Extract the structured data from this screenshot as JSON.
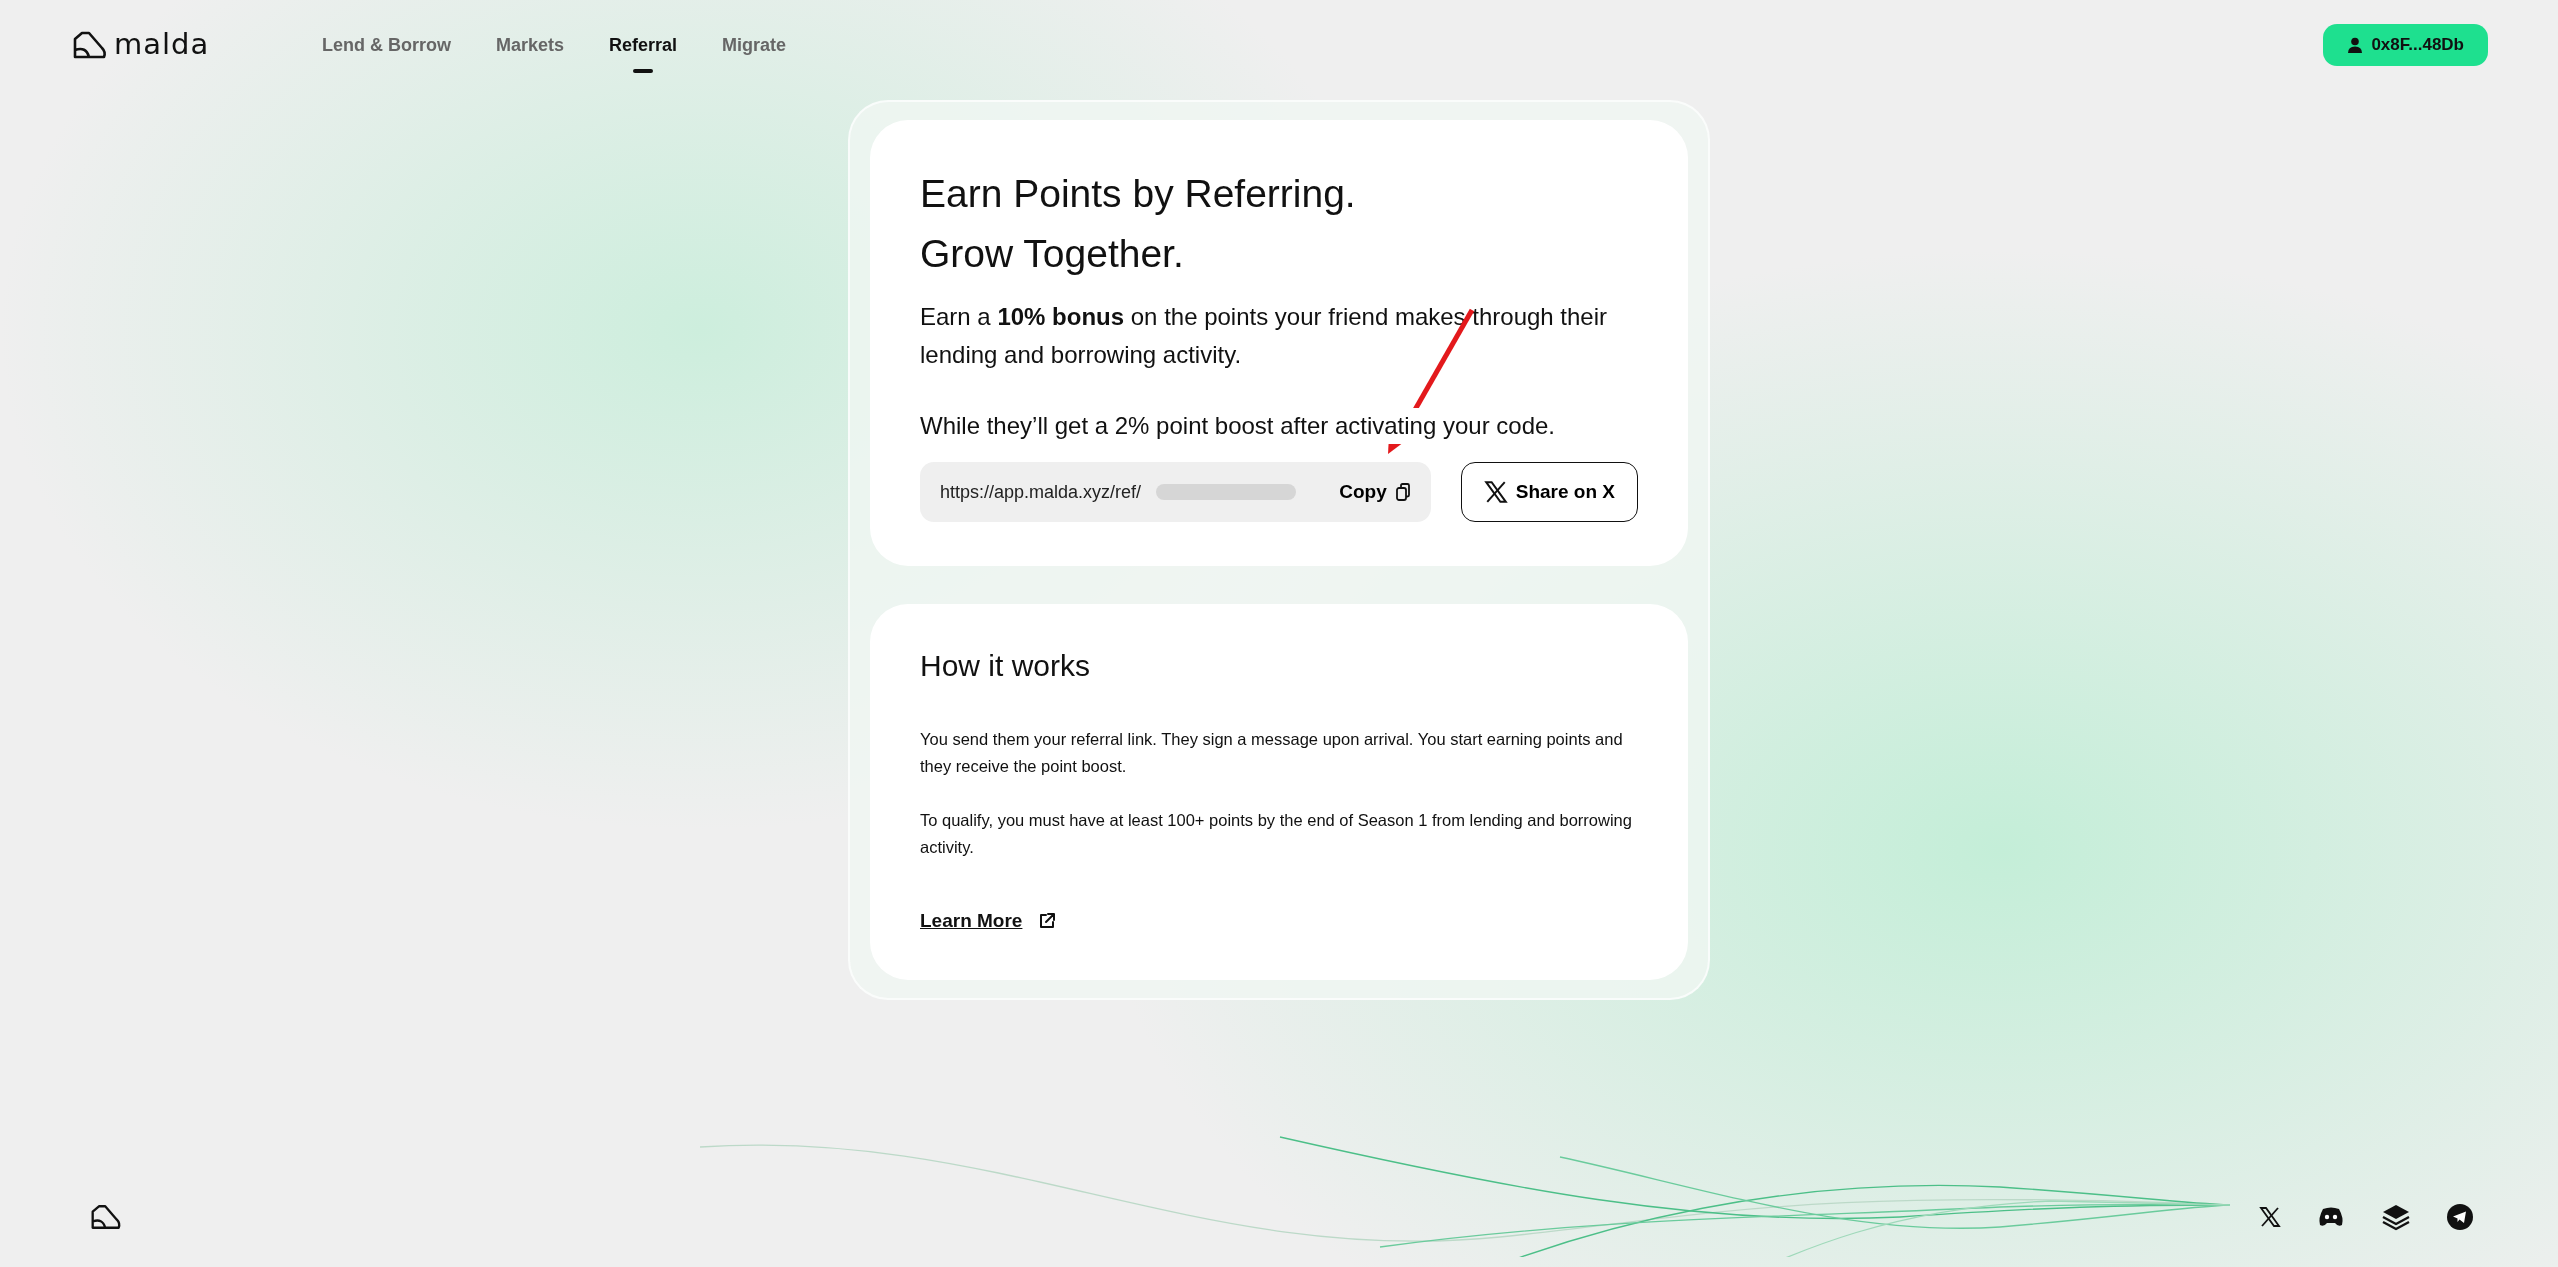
{
  "header": {
    "brand": "malda",
    "nav": [
      {
        "label": "Lend & Borrow",
        "selected": false
      },
      {
        "label": "Markets",
        "selected": false
      },
      {
        "label": "Referral",
        "selected": true
      },
      {
        "label": "Migrate",
        "selected": false
      }
    ],
    "wallet": "0x8F...48Db"
  },
  "referral_card": {
    "title_lines": [
      "Earn Points by Referring.",
      "Grow Together."
    ],
    "description": "Earn a **10% bonus** on the points your friend makes through their lending and borrowing activity.",
    "note": "While they’ll get a 2% point boost after activating your code.",
    "link_value": "https://app.malda.xyz/ref/",
    "copy_label": "Copy",
    "share_label": "Share on X"
  },
  "how_card": {
    "title": "How it works",
    "paragraphs": [
      "You send them your referral link. They sign a message upon arrival. You start earning points and they receive the point boost.",
      "To qualify, you must have at least 100+ points by the end of Season 1 from lending and borrowing activity."
    ],
    "link": "Learn More"
  }
}
